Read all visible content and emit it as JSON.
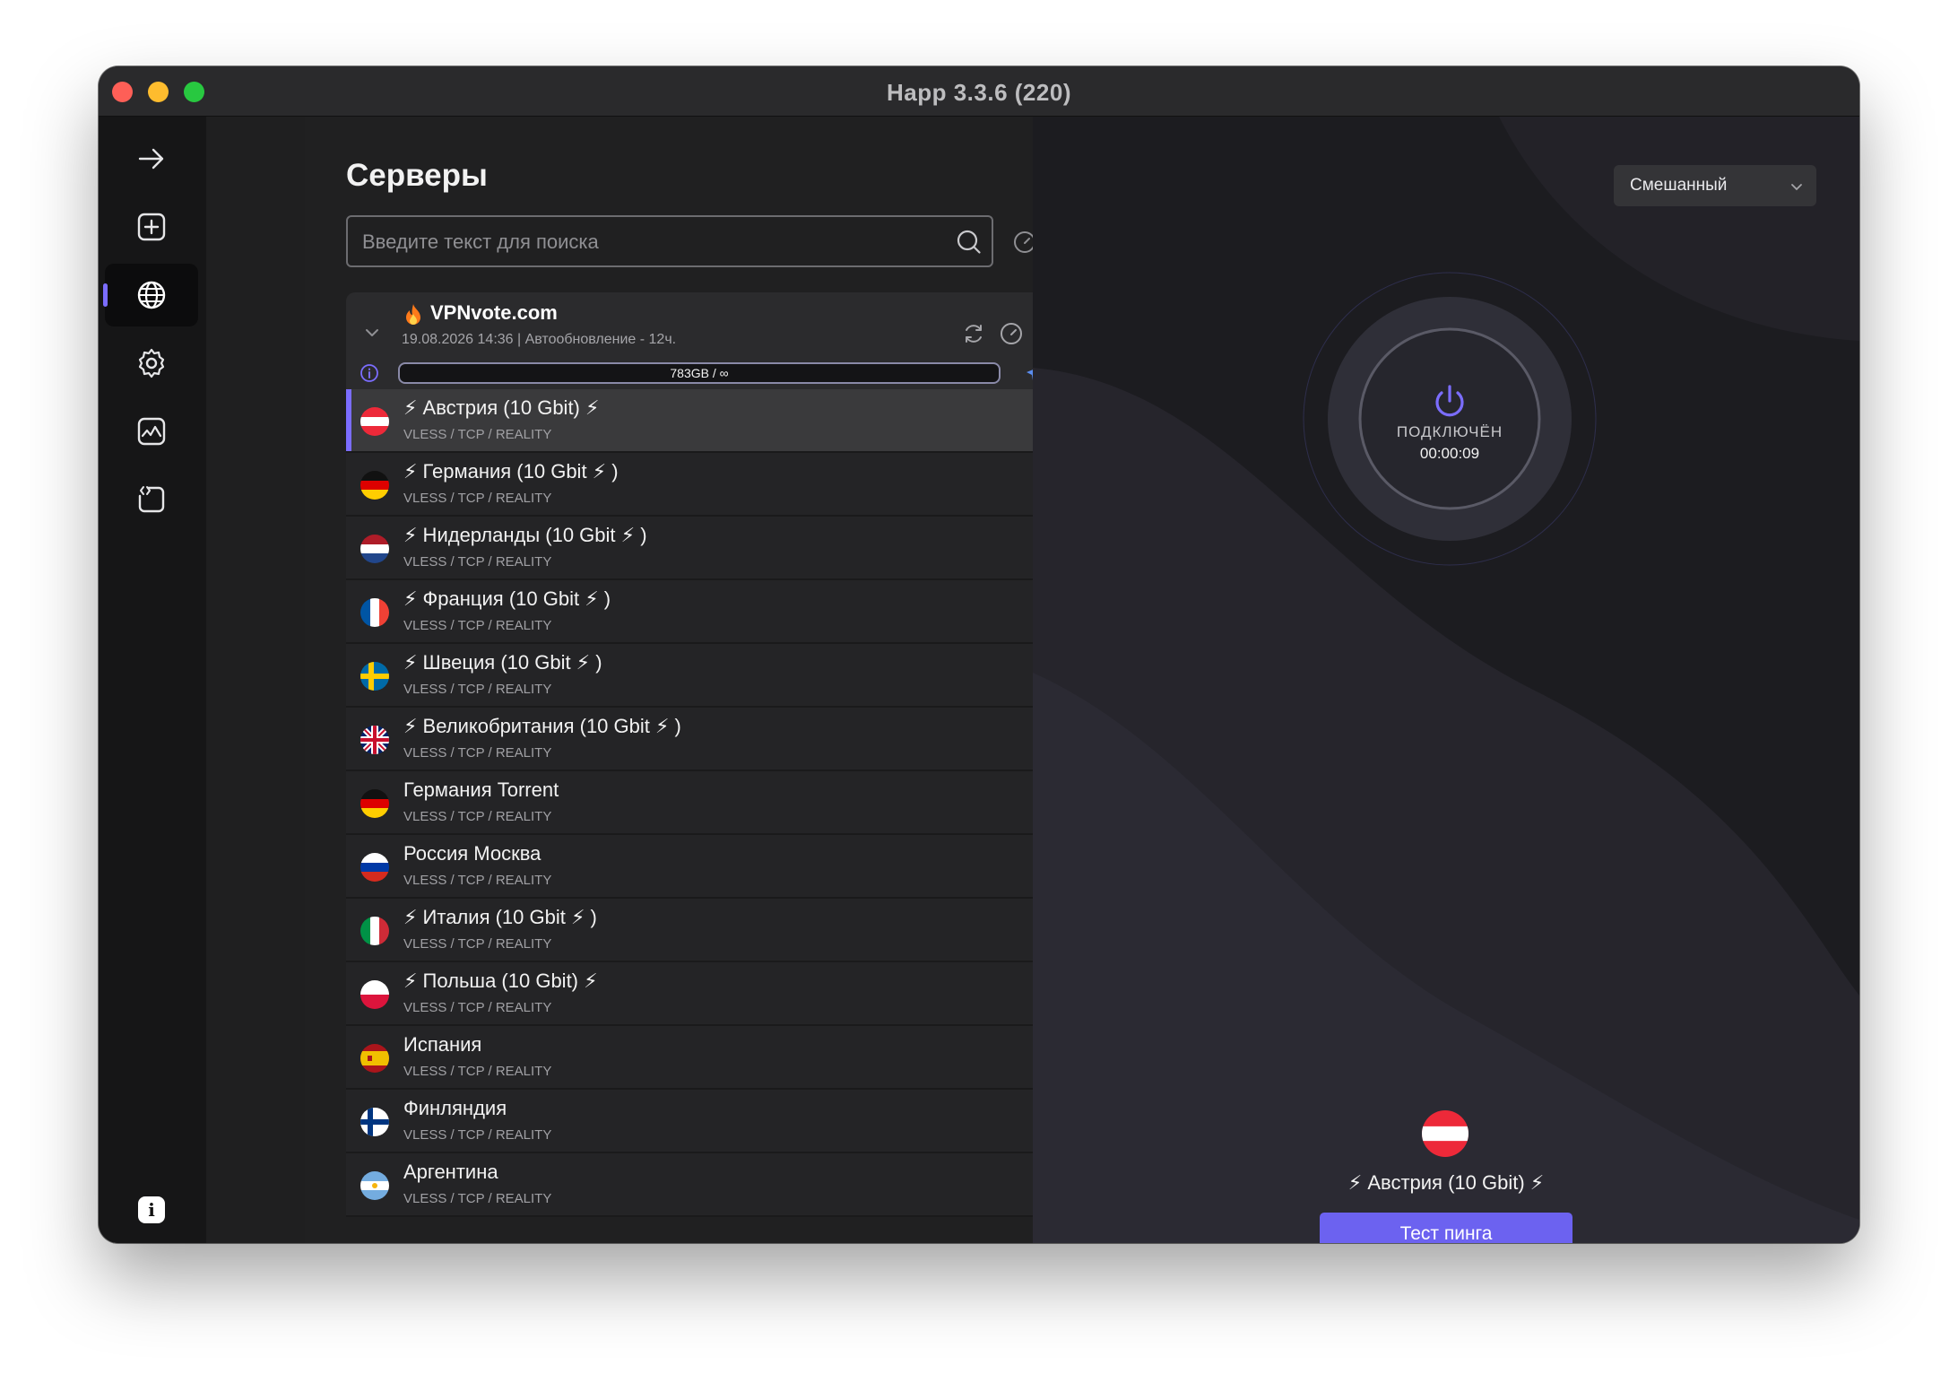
{
  "window": {
    "title": "Happ 3.3.6 (220)"
  },
  "sidebar": {
    "items": [
      {
        "icon": "arrow-right-icon"
      },
      {
        "icon": "add-square-icon"
      },
      {
        "icon": "globe-icon",
        "active": true
      },
      {
        "icon": "gear-icon"
      },
      {
        "icon": "activity-chart-icon"
      },
      {
        "icon": "code-file-icon"
      }
    ],
    "info_label": "i"
  },
  "servers": {
    "title": "Серверы",
    "search_placeholder": "Введите текст для поиска",
    "more": "···",
    "group": {
      "name": "VPNvote.com",
      "subtitle": "19.08.2026 14:36 | Автообновление - 12ч.",
      "usage": "783GB / ∞",
      "more": "···"
    },
    "rows": [
      {
        "name": "⚡ Австрия (10 Gbit) ⚡",
        "protocol": "VLESS / TCP / REALITY",
        "flag": "austria",
        "selected": true
      },
      {
        "name": "⚡ Германия (10 Gbit ⚡ )",
        "protocol": "VLESS / TCP / REALITY",
        "flag": "germany"
      },
      {
        "name": "⚡ Нидерланды (10 Gbit ⚡ )",
        "protocol": "VLESS / TCP / REALITY",
        "flag": "netherlands"
      },
      {
        "name": "⚡ Франция (10 Gbit ⚡ )",
        "protocol": "VLESS / TCP / REALITY",
        "flag": "france"
      },
      {
        "name": "⚡ Швеция (10 Gbit ⚡ )",
        "protocol": "VLESS / TCP / REALITY",
        "flag": "sweden"
      },
      {
        "name": "⚡ Великобритания (10 Gbit ⚡ )",
        "protocol": "VLESS / TCP / REALITY",
        "flag": "uk"
      },
      {
        "name": "Германия Torrent",
        "protocol": "VLESS / TCP / REALITY",
        "flag": "germany"
      },
      {
        "name": "Россия Москва",
        "protocol": "VLESS / TCP / REALITY",
        "flag": "russia"
      },
      {
        "name": "⚡ Италия (10 Gbit ⚡ )",
        "protocol": "VLESS / TCP / REALITY",
        "flag": "italy"
      },
      {
        "name": "⚡ Польша (10 Gbit) ⚡",
        "protocol": "VLESS / TCP / REALITY",
        "flag": "poland"
      },
      {
        "name": "Испания",
        "protocol": "VLESS / TCP / REALITY",
        "flag": "spain"
      },
      {
        "name": "Финляндия",
        "protocol": "VLESS / TCP / REALITY",
        "flag": "finland"
      },
      {
        "name": "Аргентина",
        "protocol": "VLESS / TCP / REALITY",
        "flag": "argentina"
      }
    ]
  },
  "connection": {
    "mode": "Смешанный",
    "status": "ПОДКЛЮЧЁН",
    "timer": "00:00:09",
    "selected_server": "⚡ Австрия (10 Gbit) ⚡",
    "selected_flag": "austria",
    "ping_button": "Тест пинга"
  },
  "colors": {
    "accent": "#7b6dff",
    "button": "#6c62f0",
    "background": "#1b1b1d"
  }
}
